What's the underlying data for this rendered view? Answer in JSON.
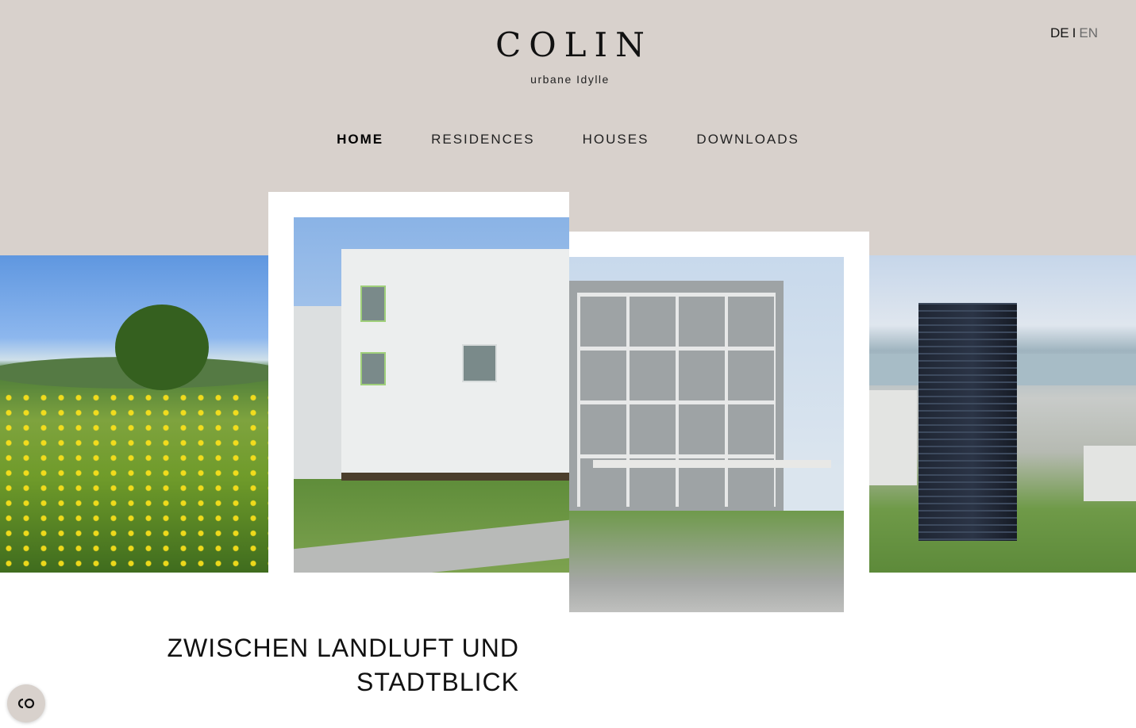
{
  "brand": {
    "name": "COLIN",
    "tagline": "urbane Idylle"
  },
  "language": {
    "active": "DE",
    "separator": "I",
    "other": "EN"
  },
  "nav": {
    "items": [
      {
        "label": "HOME",
        "active": true
      },
      {
        "label": "RESIDENCES",
        "active": false
      },
      {
        "label": "HOUSES",
        "active": false
      },
      {
        "label": "DOWNLOADS",
        "active": false
      }
    ]
  },
  "gallery": {
    "images": [
      "meadow-photo",
      "house-rendering",
      "apartment-rendering",
      "tower-aerial-photo"
    ]
  },
  "hero": {
    "headline_line1": "ZWISCHEN LANDLUFT UND",
    "headline_line2": "STADTBLICK"
  },
  "cookie": {
    "icon": "cookie-consent-icon"
  },
  "colors": {
    "band": "#d8d1cc",
    "text": "#111111",
    "background": "#ffffff"
  }
}
